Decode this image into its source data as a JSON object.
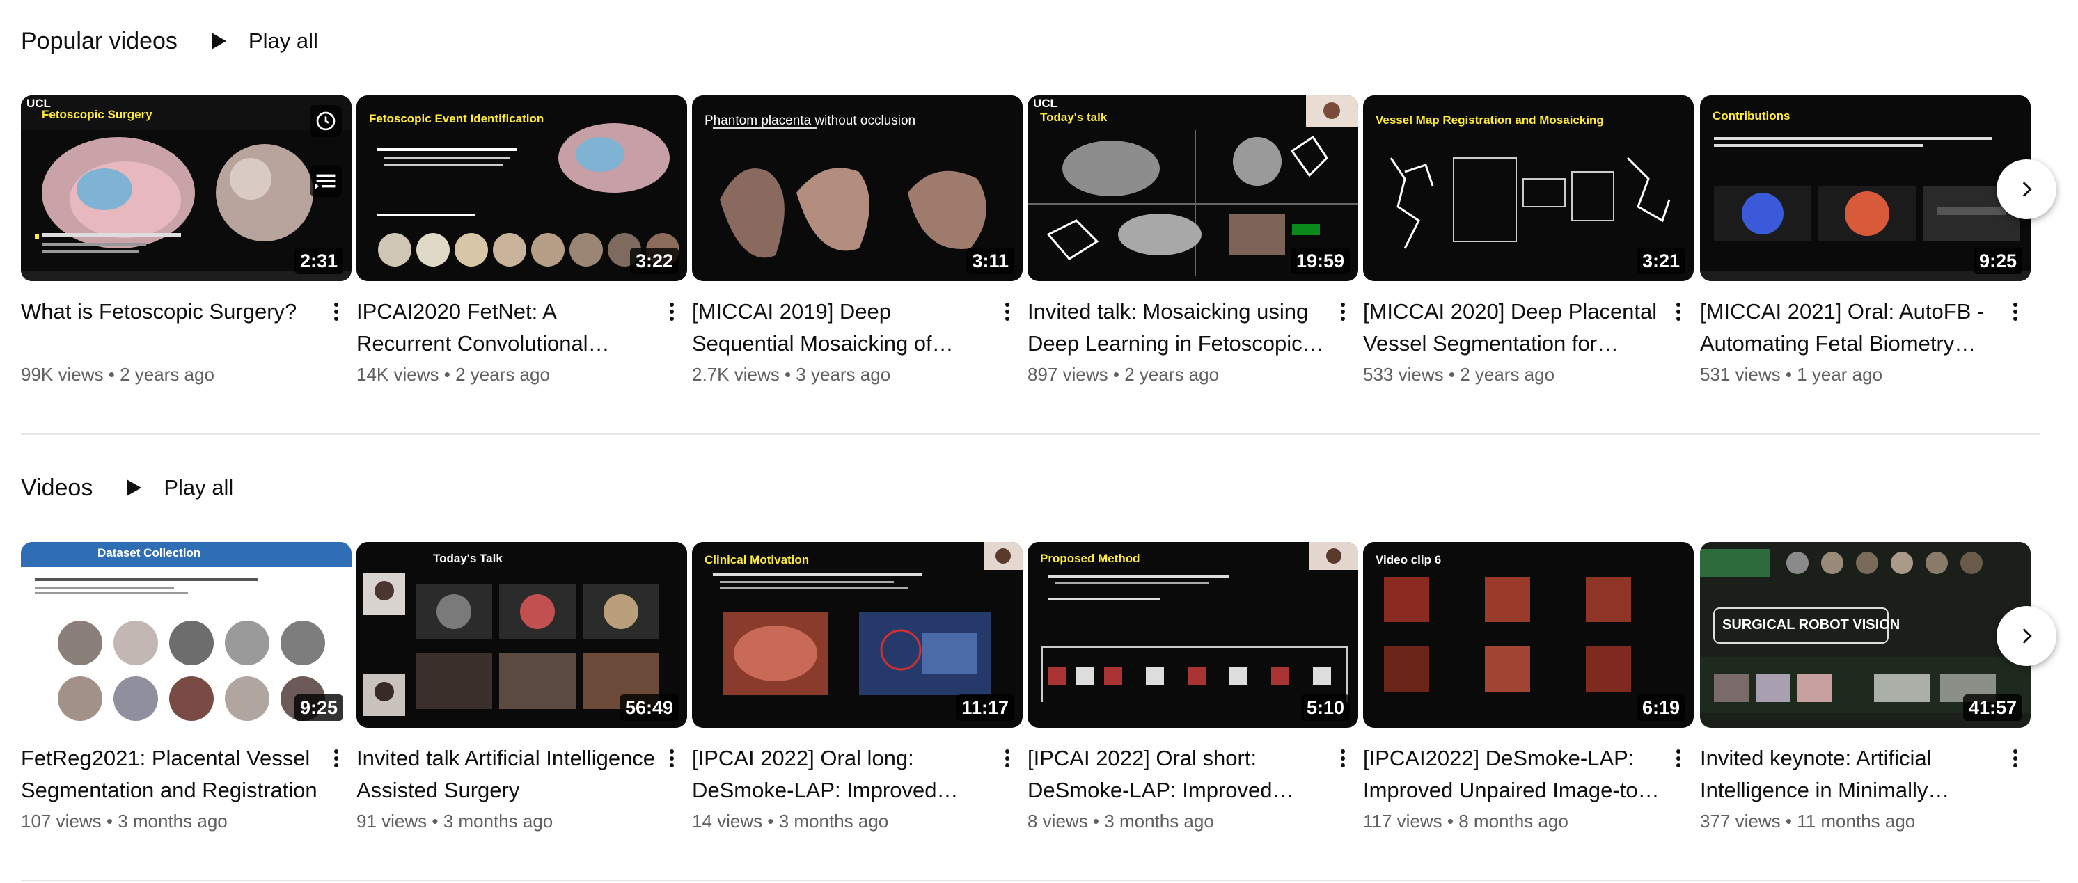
{
  "popular": {
    "title": "Popular videos",
    "play_all": "Play all",
    "videos": [
      {
        "title": "What is Fetoscopic Surgery?",
        "views": "99K views",
        "age": "2 years ago",
        "duration": "2:31",
        "slide": "Fetoscopic Surgery"
      },
      {
        "title": "IPCAI2020 FetNet: A Recurrent Convolutional Network for Occlusion Identification",
        "views": "14K views",
        "age": "2 years ago",
        "duration": "3:22",
        "slide": "Fetoscopic Event Identification"
      },
      {
        "title": "[MICCAI 2019] Deep Sequential Mosaicking of Fetoscopic Videos",
        "views": "2.7K views",
        "age": "3 years ago",
        "duration": "3:11",
        "slide": "Phantom placenta without occlusion"
      },
      {
        "title": "Invited talk: Mosaicking using Deep Learning in Fetoscopic Surgery",
        "views": "897 views",
        "age": "2 years ago",
        "duration": "19:59",
        "slide": "Today's talk"
      },
      {
        "title": "[MICCAI 2020] Deep Placental Vessel Segmentation for Fetoscopic Mosaicking",
        "views": "533 views",
        "age": "2 years ago",
        "duration": "3:21",
        "slide": "Vessel Map Registration and Mosaicking"
      },
      {
        "title": "[MICCAI 2021] Oral: AutoFB - Automating Fetal Biometry Estimation",
        "views": "531 views",
        "age": "1 year ago",
        "duration": "9:25",
        "slide": "Contributions"
      }
    ]
  },
  "videos": {
    "title": "Videos",
    "play_all": "Play all",
    "videos": [
      {
        "title": "FetReg2021: Placental Vessel Segmentation and Registration",
        "views": "107 views",
        "age": "3 months ago",
        "duration": "9:25",
        "slide": "Dataset Collection"
      },
      {
        "title": "Invited talk Artificial Intelligence Assisted Surgery",
        "views": "91 views",
        "age": "3 months ago",
        "duration": "56:49",
        "slide": "Today's Talk"
      },
      {
        "title": "[IPCAI 2022] Oral long: DeSmoke-LAP: Improved Unpaired Image-to-Image Translation",
        "views": "14 views",
        "age": "3 months ago",
        "duration": "11:17",
        "slide": "Clinical Motivation"
      },
      {
        "title": "[IPCAI 2022] Oral short: DeSmoke-LAP: Improved Unpaired Image-to-Image Translation",
        "views": "8 views",
        "age": "3 months ago",
        "duration": "5:10",
        "slide": "Proposed Method"
      },
      {
        "title": "[IPCAI2022] DeSmoke-LAP: Improved Unpaired Image-to-Image Translation",
        "views": "117 views",
        "age": "8 months ago",
        "duration": "6:19",
        "slide": "Video clip 6"
      },
      {
        "title": "Invited keynote: Artificial Intelligence in Minimally Invasive Surgery",
        "views": "377 views",
        "age": "11 months ago",
        "duration": "41:57",
        "slide": "SURGICAL ROBOT VISION"
      }
    ]
  },
  "ucl_label": "UCL",
  "icons": {
    "play": "play-icon",
    "more": "more-vert-icon",
    "next": "chevron-right-icon",
    "watch_later": "clock-icon",
    "queue": "add-to-queue-icon"
  },
  "colors": {
    "text": "#0f0f0f",
    "secondary": "#606060",
    "divider": "#e5e5e5",
    "slide_title": "#ffeb3b"
  }
}
